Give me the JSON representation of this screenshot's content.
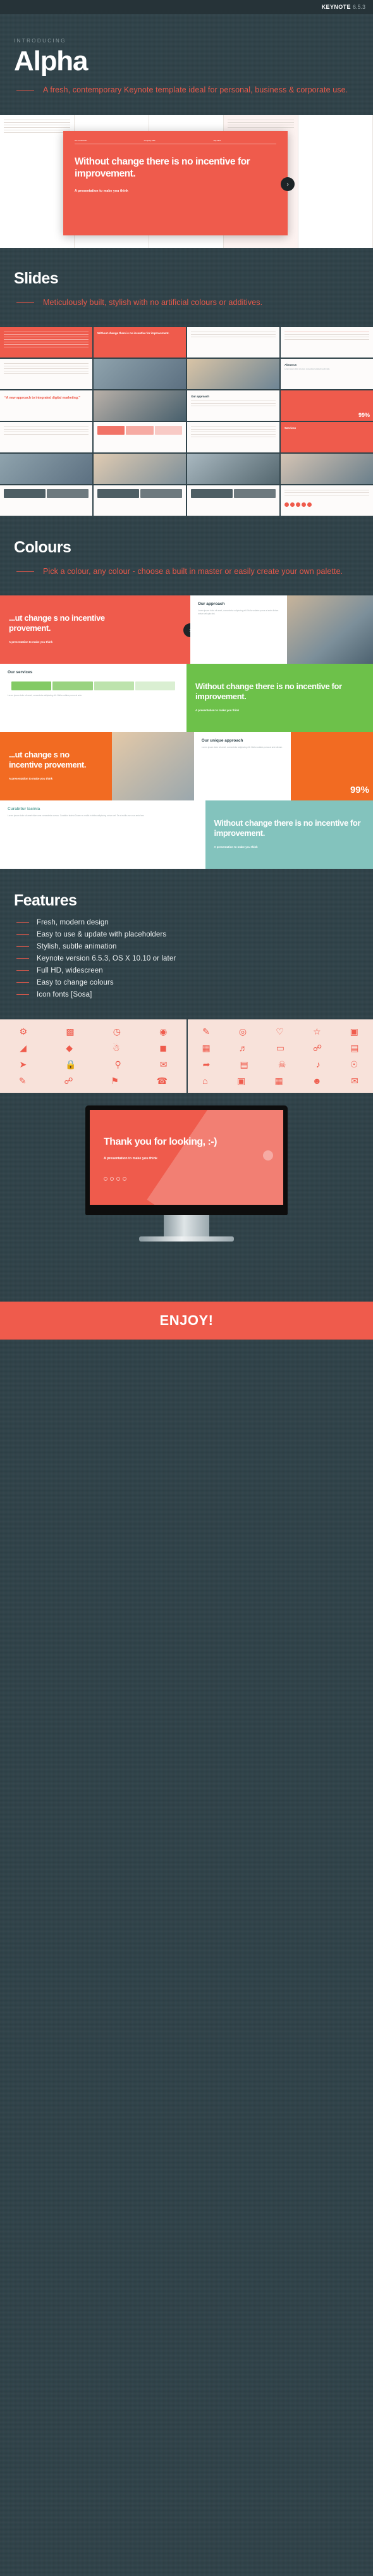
{
  "topbar": {
    "app": "KEYNOTE",
    "version": "6.5.3"
  },
  "intro": {
    "eyebrow": "INTRODUCING",
    "title": "Alpha",
    "tagline": "A fresh, contemporary Keynote template ideal for personal, business & corporate use."
  },
  "hero": {
    "meta": [
      "Our Credentials",
      "Company ABC",
      "July 2015"
    ],
    "quote": "Without change there is no incentive for improvement.",
    "subtitle": "A presentation to make you think",
    "next_arrow": "›"
  },
  "sections": {
    "slides": {
      "title": "Slides",
      "tagline": "Meticulously built, stylish with no artificial colours or additives."
    },
    "colours": {
      "title": "Colours",
      "tagline": "Pick a colour, any colour - choose a built in master or easily create your own palette."
    },
    "features": {
      "title": "Features",
      "items": [
        "Fresh, modern design",
        "Easy to use & update with placeholders",
        "Stylish, subtle animation",
        "Keynote version 6.5.3, OS X 10.10 or later",
        "Full HD, widescreen",
        "Easy to change colours",
        "Icon fonts [Sosa]"
      ]
    }
  },
  "slide_thumbs": [
    {
      "kind": "lines-red",
      "title": ""
    },
    {
      "kind": "quote-red",
      "title": "Without change there is no incentive for improvement."
    },
    {
      "kind": "arrow",
      "title": ""
    },
    {
      "kind": "text",
      "title": ""
    },
    {
      "kind": "text",
      "title": ""
    },
    {
      "kind": "photo",
      "title": ""
    },
    {
      "kind": "photo",
      "title": ""
    },
    {
      "kind": "text",
      "title": "About us"
    },
    {
      "kind": "quote",
      "title": "“A new approach to integrated digital marketing.”"
    },
    {
      "kind": "photo",
      "title": ""
    },
    {
      "kind": "text",
      "title": "Our approach"
    },
    {
      "kind": "stat-red",
      "title": "99%"
    },
    {
      "kind": "text",
      "title": ""
    },
    {
      "kind": "text",
      "title": ""
    },
    {
      "kind": "text",
      "title": ""
    },
    {
      "kind": "red",
      "title": "Services"
    },
    {
      "kind": "photo",
      "title": ""
    },
    {
      "kind": "photo",
      "title": ""
    },
    {
      "kind": "photo",
      "title": ""
    },
    {
      "kind": "photo",
      "title": ""
    },
    {
      "kind": "logos",
      "title": ""
    },
    {
      "kind": "logos",
      "title": ""
    },
    {
      "kind": "logos",
      "title": ""
    },
    {
      "kind": "contact",
      "title": ""
    }
  ],
  "colour_bands": [
    {
      "accent": "#ef5b4c",
      "quote": "...ut change s no incentive provement.",
      "sub": "A presentation to make you think",
      "panel_title": "Our approach",
      "panel_body": "Lorem ipsum dolor sit amet, consectetur adipiscing elit. Nulla sodales purus at ante dictum rutrum vel quis nisi."
    },
    {
      "accent": "#6dc14a",
      "quote": "Without change there is no incentive for improvement.",
      "sub": "A presentation to make you think",
      "panel_title": "Our services",
      "panel_body": "Lorem ipsum dolor sit amet, consectetur adipiscing elit. Nulla sodales purus at ante."
    },
    {
      "accent": "#f26b22",
      "quote": "...ut change s no incentive provement.",
      "sub": "A presentation to make you think",
      "panel_title": "Our unique approach",
      "panel_body": "Lorem ipsum dolor sit amet, consectetur adipiscing elit. Nulla sodales purus at ante dictum.",
      "stat": "99%"
    },
    {
      "accent": "#83c3bd",
      "quote": "Without change there is no incentive for improvement.",
      "sub": "A presentation to make you think",
      "panel_title": "Curabitur lacinia",
      "panel_body": "Lorem ipsum dolor sit amet vitae urna consectetur cursus. Curabitur lacinia Donec eu mollis in tellus adipiscing rutrum vel. Te at mollis avec sur amic lem."
    }
  ],
  "icons": {
    "left": [
      [
        "gear-icon",
        "bar-chart-icon",
        "clock-icon",
        "globe-icon"
      ],
      [
        "chart-line-icon",
        "tag-icon",
        "bulb-icon",
        "shield-icon"
      ],
      [
        "arrow-icon",
        "lock-icon",
        "key-icon",
        "envelope-icon"
      ],
      [
        "pencil-icon",
        "link-icon",
        "flag-icon",
        "phone-icon"
      ]
    ],
    "right": [
      [
        "pencil-icon",
        "broadcast-icon",
        "heart-icon",
        "star-icon",
        "camera-icon"
      ],
      [
        "book-icon",
        "megaphone-icon",
        "mobile-icon",
        "paperclip-icon",
        "bag-icon"
      ],
      [
        "share-icon",
        "truck-icon",
        "trophy-icon",
        "music-icon",
        "bell-icon"
      ],
      [
        "home-icon",
        "cart-icon",
        "map-icon",
        "user-icon",
        "mail-icon"
      ]
    ]
  },
  "thankyou": {
    "title": "Thank you for looking, :-)",
    "subtitle": "A presentation to make you think"
  },
  "footer": {
    "enjoy": "ENJOY!"
  },
  "palette": {
    "dark": "#2f4249",
    "red": "#ef5b4c",
    "green": "#6dc14a",
    "orange": "#f26b22",
    "teal": "#83c3bd",
    "cream": "#f8e2da"
  }
}
